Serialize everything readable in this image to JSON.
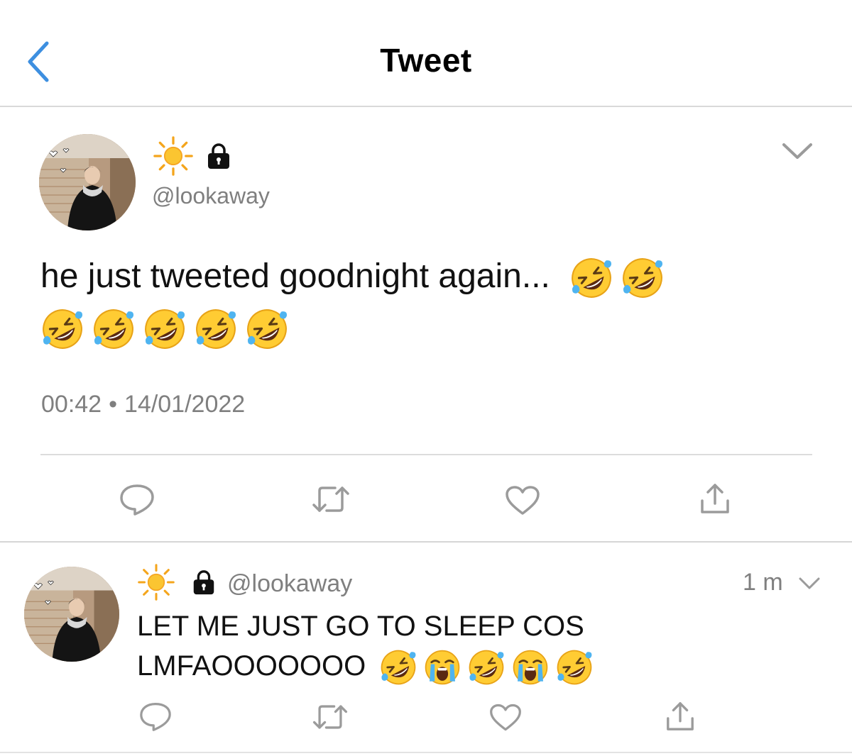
{
  "header": {
    "title": "Tweet",
    "back_icon": "chevron-left-icon",
    "accent_color": "#3d8fe0"
  },
  "main_tweet": {
    "display_name_icons": [
      "sun-emoji",
      "lock-icon"
    ],
    "handle": "@lookaway",
    "text_line1": "he just tweeted goodnight again...",
    "text_emojis_line1": [
      "rolling-on-floor-laughing",
      "rolling-on-floor-laughing"
    ],
    "text_emojis_line2": [
      "rolling-on-floor-laughing",
      "rolling-on-floor-laughing",
      "rolling-on-floor-laughing",
      "rolling-on-floor-laughing",
      "rolling-on-floor-laughing"
    ],
    "time": "00:42",
    "separator": "•",
    "date": "14/01/2022",
    "actions": [
      "reply-icon",
      "retweet-icon",
      "like-icon",
      "share-icon"
    ]
  },
  "reply_tweet": {
    "display_name_icons": [
      "sun-emoji",
      "lock-icon"
    ],
    "handle": "@lookaway",
    "time_ago": "1 m",
    "text_line1": "LET ME JUST GO TO SLEEP COS",
    "text_line2": "LMFAOOOOOOO",
    "text_emojis": [
      "rolling-on-floor-laughing",
      "loudly-crying",
      "rolling-on-floor-laughing",
      "loudly-crying",
      "rolling-on-floor-laughing"
    ],
    "actions": [
      "reply-icon",
      "retweet-icon",
      "like-icon",
      "share-icon"
    ]
  }
}
